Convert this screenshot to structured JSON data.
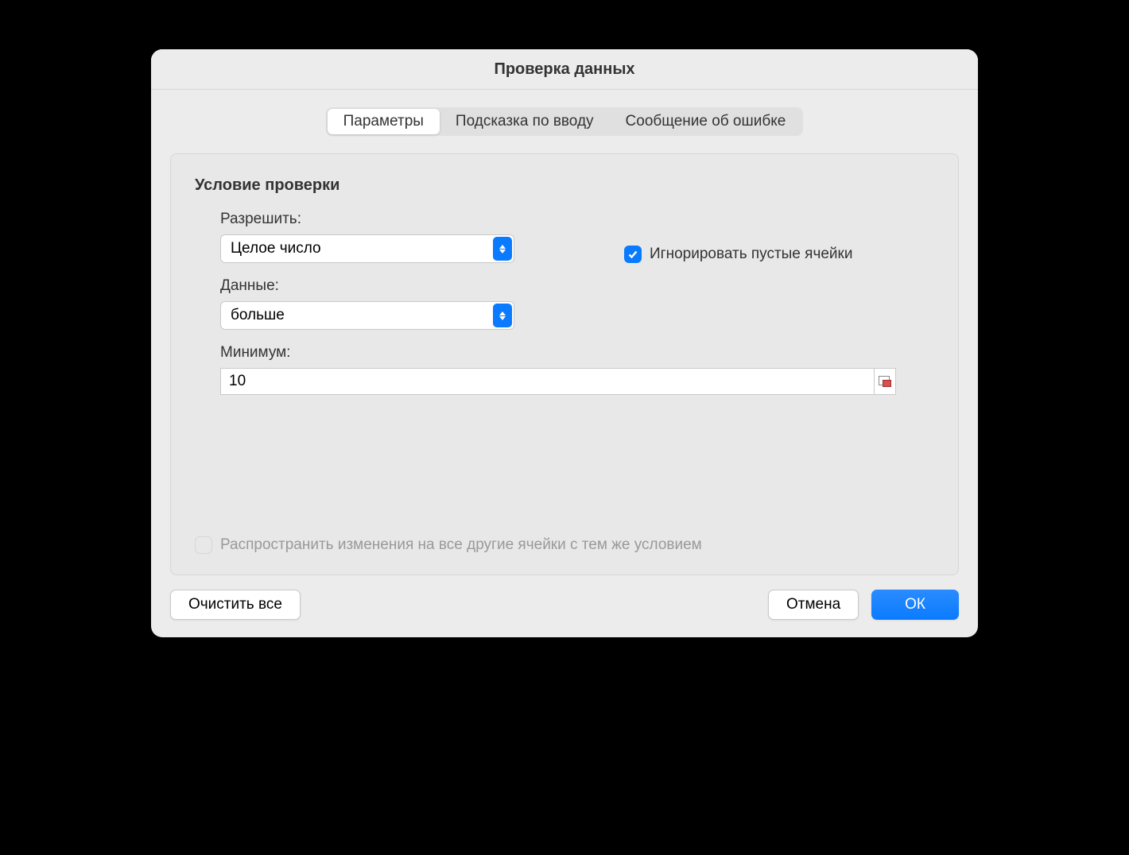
{
  "dialog": {
    "title": "Проверка данных"
  },
  "tabs": {
    "settings": "Параметры",
    "input_message": "Подсказка по вводу",
    "error_alert": "Сообщение об ошибке"
  },
  "panel": {
    "section_title": "Условие проверки",
    "allow_label": "Разрешить:",
    "allow_value": "Целое число",
    "data_label": "Данные:",
    "data_value": "больше",
    "minimum_label": "Минимум:",
    "minimum_value": "10",
    "ignore_blank_label": "Игнорировать пустые ячейки",
    "ignore_blank_checked": true,
    "propagate_label": "Распространить изменения на все другие ячейки с тем же условием",
    "propagate_checked": false
  },
  "buttons": {
    "clear_all": "Очистить все",
    "cancel": "Отмена",
    "ok": "ОК"
  }
}
